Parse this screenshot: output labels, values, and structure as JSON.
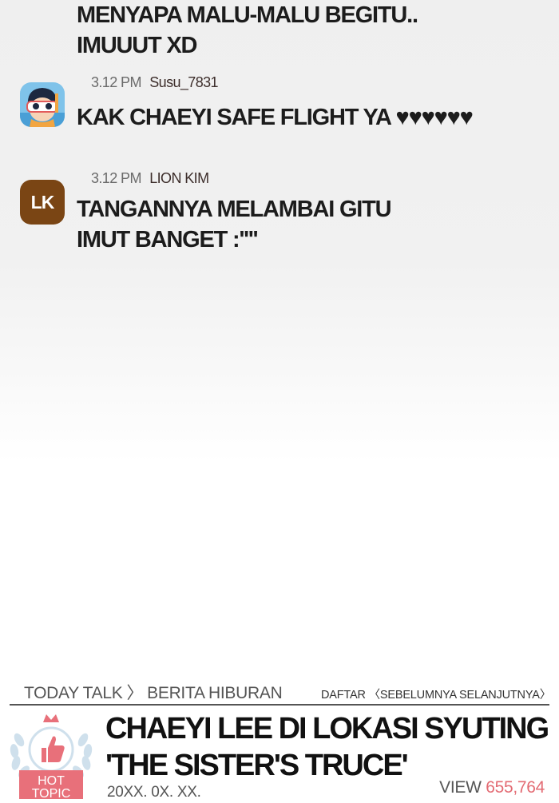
{
  "comments": [
    {
      "text_lines": [
        "MENYAPA MALU-MALU BEGITU..",
        "IMUUUT XD"
      ]
    },
    {
      "time": "3.12 PM",
      "username": "Susu_7831",
      "text": "KAK CHAEYI SAFE FLIGHT YA ♥♥♥♥♥♥",
      "avatar_icon": "diver-character-icon"
    },
    {
      "time": "3.12 PM",
      "username": "LION KIM",
      "avatar_initials": "LK",
      "avatar_color": "#7a4514",
      "text_lines": [
        "TANGANNYA MELAMBAI GITU",
        "IMUT BANGET :''''"
      ]
    }
  ],
  "article": {
    "breadcrumb": {
      "section": "TODAY TALK",
      "separator": "〉",
      "category": "BERITA HIBURAN"
    },
    "nav": {
      "list": "DAFTAR",
      "prev_marker": "〈",
      "prev": "SEBELUMNYA",
      "next": "SELANJUTNYA",
      "next_marker": "〉"
    },
    "badge": {
      "line1": "HOT",
      "line2": "TOPIC",
      "icon": "thumbs-up-laurel-icon",
      "color": "#e8707a"
    },
    "headline_lines": [
      "CHAEYI LEE DI LOKASI SYUTING",
      "'THE SISTER'S TRUCE'"
    ],
    "date": "20XX. 0X. XX.",
    "views_label": "VIEW",
    "views_count": "655,764",
    "views_color": "#e36b73"
  }
}
